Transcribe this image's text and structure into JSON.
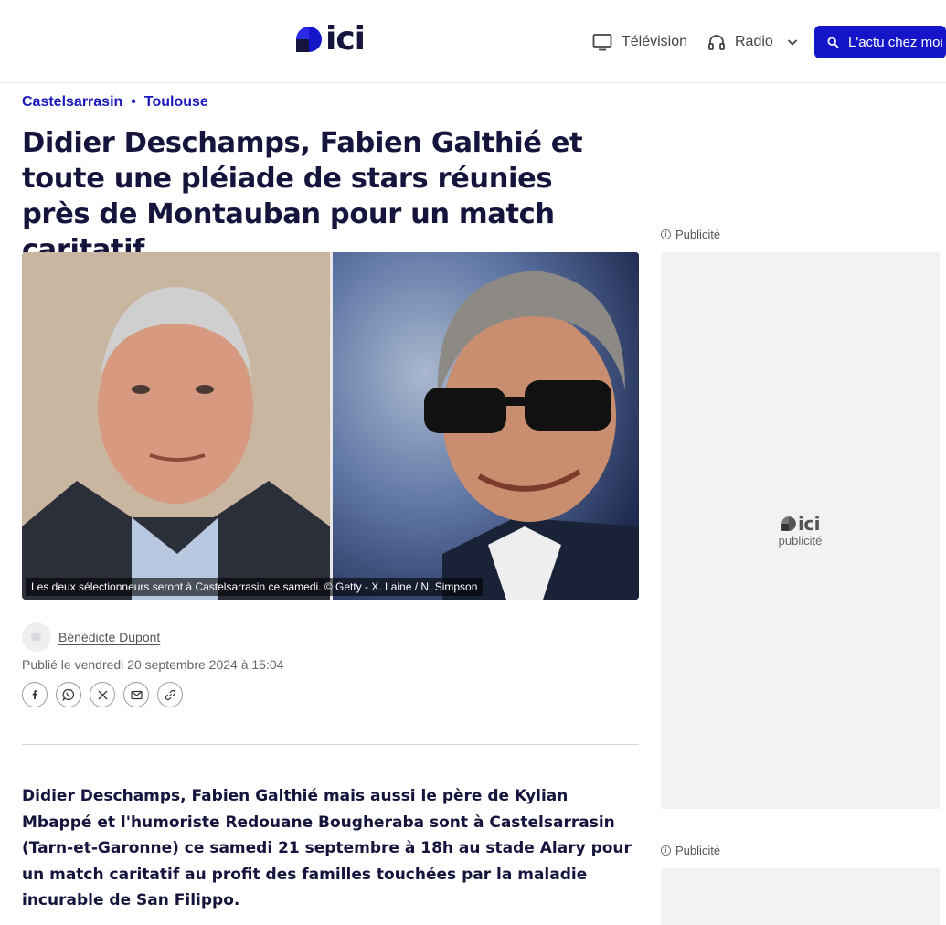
{
  "header": {
    "logo_text": "ici",
    "nav_tv": "Télévision",
    "nav_radio": "Radio",
    "cta": "L'actu chez moi",
    "icons": [
      "tv-icon",
      "headphones-icon",
      "chevron-down-icon",
      "search-icon"
    ]
  },
  "breadcrumb": [
    "Castelsarrasin",
    "Toulouse"
  ],
  "article": {
    "title": "Didier Deschamps, Fabien Galthié et toute une pléiade de stars réunies près de Montauban pour un match caritatif",
    "image_caption": "Les deux sélectionneurs seront à Castelsarrasin ce samedi. © Getty - X. Laine / N. Simpson",
    "author": "Bénédicte Dupont",
    "published": "Publié le vendredi 20 septembre 2024 à 15:04",
    "lead": "Didier Deschamps, Fabien Galthié mais aussi le père de Kylian Mbappé et l'humoriste Redouane Bougheraba sont à Castelsarrasin (Tarn-et-Garonne) ce samedi 21 septembre à 18h au stade Alary pour un match caritatif au profit des familles touchées par la maladie incurable de San Filippo."
  },
  "share": [
    "facebook-icon",
    "whatsapp-icon",
    "x-icon",
    "email-icon",
    "link-icon"
  ],
  "sidebar": {
    "ad_label_1": "Publicité",
    "ad_label_2": "Publicité",
    "ad_logo": "ici",
    "ad_text": "publicité"
  },
  "colors": {
    "brand_blue": "#1414c8",
    "title_navy": "#14143c",
    "breadcrumb_blue": "#1a1ab8"
  }
}
